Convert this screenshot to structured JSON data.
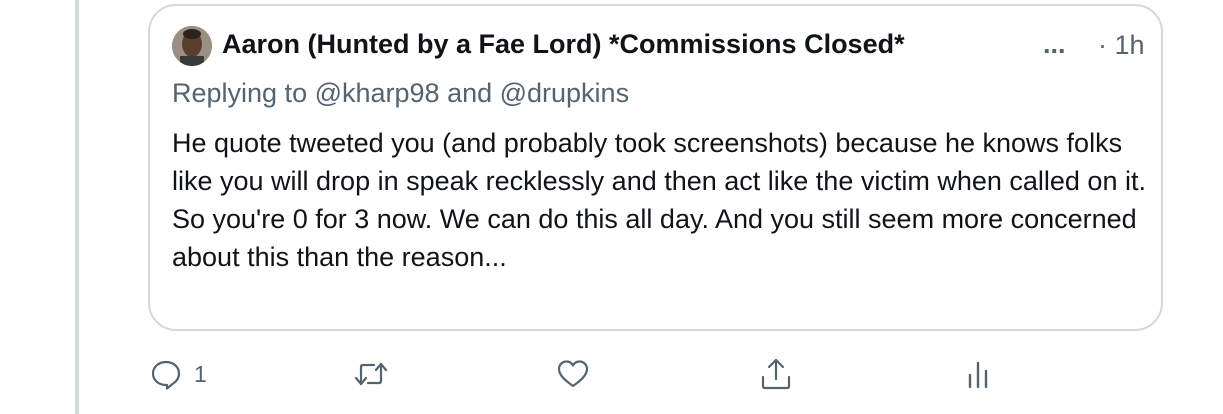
{
  "quote": {
    "author_name": "Aaron (Hunted by a Fae Lord) *Commissions Closed*",
    "ellipsis": "...",
    "timestamp": "· 1h",
    "replying_to": "Replying to @kharp98 and @drupkins",
    "text": "He quote tweeted you (and probably took screenshots) because he knows folks like you will drop in speak recklessly and then act like the victim when called on it. So you're 0 for 3 now. We can do this all day. And you still seem more concerned about this than the reason..."
  },
  "actions": {
    "reply_count": "1",
    "icons": [
      "reply-icon",
      "retweet-icon",
      "like-icon",
      "share-icon",
      "analytics-icon"
    ]
  },
  "colors": {
    "text_primary": "#0f1419",
    "text_secondary": "#536471",
    "border": "#cfd9de"
  }
}
